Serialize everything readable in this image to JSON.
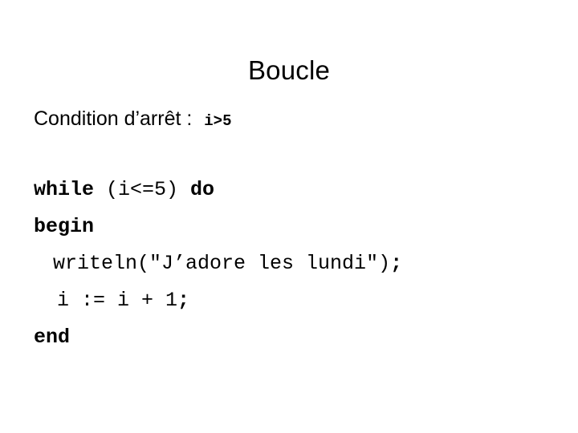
{
  "slide": {
    "title": "Boucle",
    "background_color": "#ffffff",
    "text_color": "#000000"
  },
  "condition": {
    "label": "Condition d’arrêt : ",
    "expression": "i>5"
  },
  "code": {
    "lines": [
      {
        "indent": 0,
        "segments": [
          {
            "text": "while ",
            "style": "keyword"
          },
          {
            "text": "(i<=5) ",
            "style": "plain"
          },
          {
            "text": "do",
            "style": "keyword"
          }
        ]
      },
      {
        "indent": 0,
        "segments": [
          {
            "text": "begin",
            "style": "keyword"
          }
        ]
      },
      {
        "indent": 1,
        "segments": [
          {
            "text": "writeln(\"J’adore les lundi\")",
            "style": "plain"
          },
          {
            "text": ";",
            "style": "punct-bold"
          }
        ]
      },
      {
        "indent": 2,
        "segments": [
          {
            "text": "i := i + 1",
            "style": "plain"
          },
          {
            "text": ";",
            "style": "punct-bold"
          }
        ]
      },
      {
        "indent": 0,
        "segments": [
          {
            "text": "end",
            "style": "keyword"
          }
        ]
      }
    ]
  }
}
